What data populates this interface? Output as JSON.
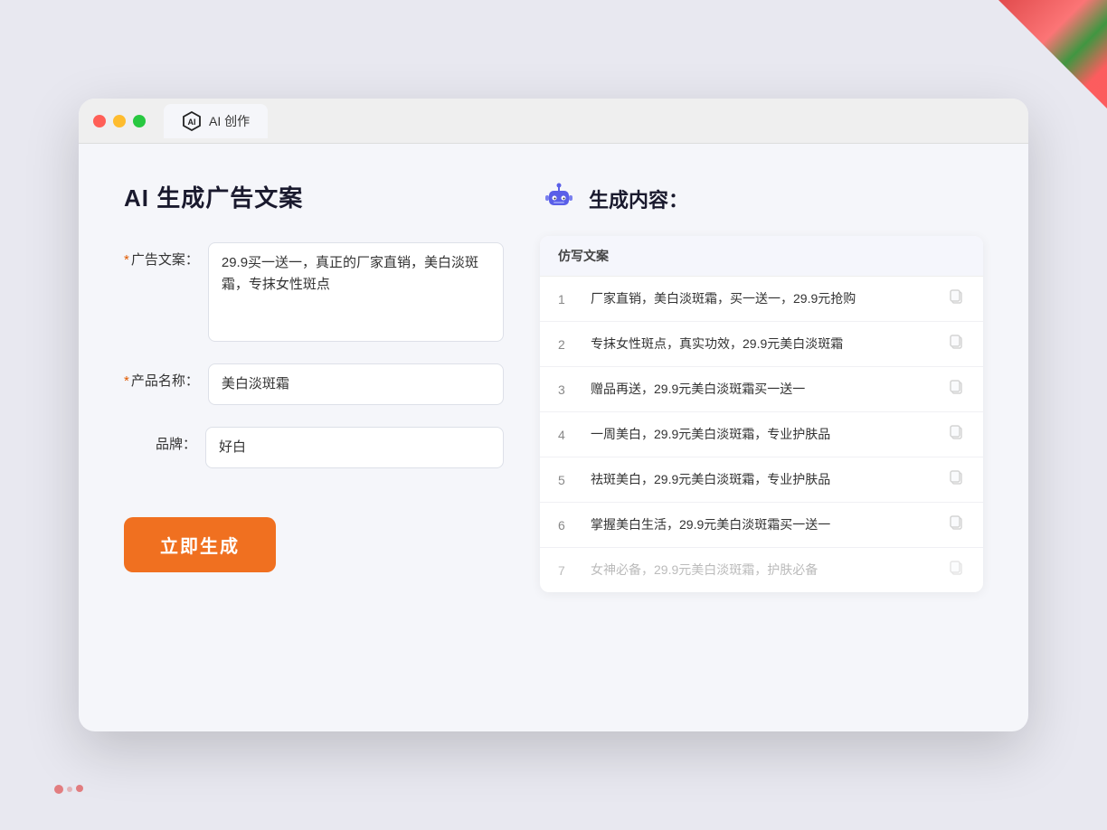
{
  "browser": {
    "tab_label": "AI 创作",
    "traffic_lights": [
      "red",
      "yellow",
      "green"
    ]
  },
  "page": {
    "title": "AI 生成广告文案",
    "form": {
      "ad_copy_label": "广告文案：",
      "ad_copy_required": "*",
      "ad_copy_value": "29.9买一送一，真正的厂家直销，美白淡斑霜，专抹女性斑点",
      "product_name_label": "产品名称：",
      "product_name_required": "*",
      "product_name_value": "美白淡斑霜",
      "brand_label": "品牌：",
      "brand_value": "好白",
      "generate_btn": "立即生成"
    },
    "result": {
      "header_title": "生成内容：",
      "table_header": "仿写文案",
      "rows": [
        {
          "num": "1",
          "text": "厂家直销，美白淡斑霜，买一送一，29.9元抢购",
          "faded": false
        },
        {
          "num": "2",
          "text": "专抹女性斑点，真实功效，29.9元美白淡斑霜",
          "faded": false
        },
        {
          "num": "3",
          "text": "赠品再送，29.9元美白淡斑霜买一送一",
          "faded": false
        },
        {
          "num": "4",
          "text": "一周美白，29.9元美白淡斑霜，专业护肤品",
          "faded": false
        },
        {
          "num": "5",
          "text": "祛斑美白，29.9元美白淡斑霜，专业护肤品",
          "faded": false
        },
        {
          "num": "6",
          "text": "掌握美白生活，29.9元美白淡斑霜买一送一",
          "faded": false
        },
        {
          "num": "7",
          "text": "女神必备，29.9元美白淡斑霜，护肤必备",
          "faded": true
        }
      ]
    }
  }
}
